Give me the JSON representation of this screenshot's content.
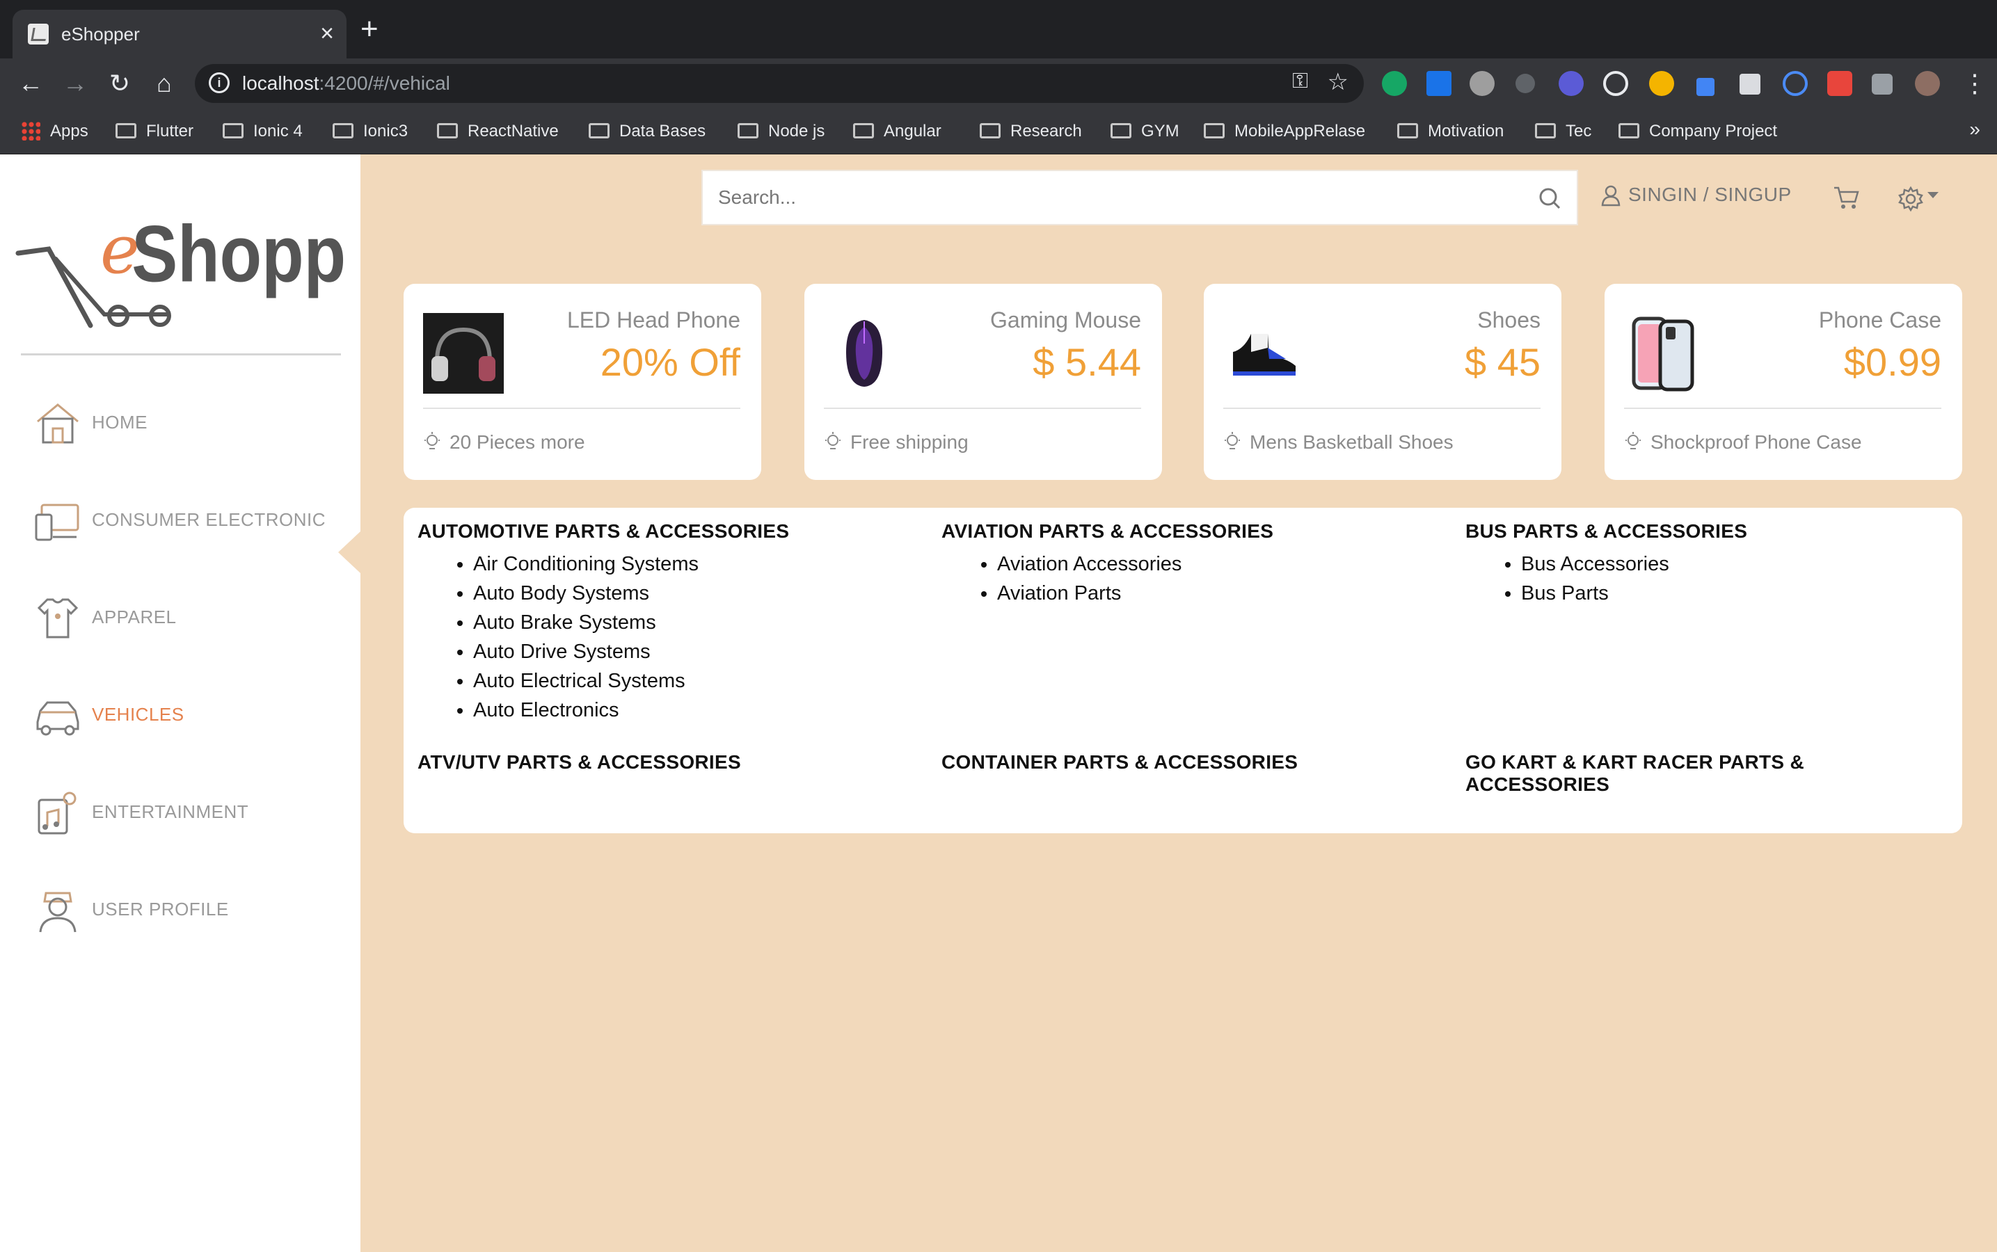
{
  "browser": {
    "tab_title": "eShopper",
    "url_host": "localhost",
    "url_path": ":4200/#/vehical",
    "bookmarks": [
      "Apps",
      "Flutter",
      "Ionic 4",
      "Ionic3",
      "ReactNative",
      "Data Bases",
      "Node js",
      "Angular",
      "Research",
      "GYM",
      "MobileAppRelase",
      "Motivation",
      "Tec",
      "Company Project"
    ],
    "more": "»"
  },
  "sidebar": {
    "items": [
      {
        "label": "HOME",
        "icon": "home-icon"
      },
      {
        "label": "CONSUMER ELECTRONIC",
        "icon": "devices-icon"
      },
      {
        "label": "APPAREL",
        "icon": "shirt-icon"
      },
      {
        "label": "VEHICLES",
        "icon": "car-icon",
        "active": true
      },
      {
        "label": "ENTERTAINMENT",
        "icon": "music-icon"
      },
      {
        "label": "USER PROFILE",
        "icon": "user-icon"
      }
    ],
    "active_color": "#e5824d"
  },
  "header": {
    "search_placeholder": "Search...",
    "signin_label": "SINGIN / SINGUP"
  },
  "deals": [
    {
      "name": "LED Head Phone",
      "price": "20% Off",
      "note": "20 Pieces more",
      "icon": "headphone-image"
    },
    {
      "name": "Gaming Mouse",
      "price": "$ 5.44",
      "note": "Free shipping",
      "icon": "mouse-image"
    },
    {
      "name": "Shoes",
      "price": "$ 45",
      "note": "Mens Basketball Shoes",
      "icon": "shoe-image"
    },
    {
      "name": "Phone Case",
      "price": "$0.99",
      "note": "Shockproof Phone Case",
      "icon": "phone-case-image"
    }
  ],
  "categories": [
    {
      "title": "AUTOMOTIVE PARTS & ACCESSORIES",
      "items": [
        "Air Conditioning Systems",
        "Auto Body Systems",
        "Auto Brake Systems",
        "Auto Drive Systems",
        "Auto Electrical Systems",
        "Auto Electronics"
      ]
    },
    {
      "title": "AVIATION PARTS & ACCESSORIES",
      "items": [
        "Aviation Accessories",
        "Aviation Parts"
      ]
    },
    {
      "title": "BUS PARTS & ACCESSORIES",
      "items": [
        "Bus Accessories",
        "Bus Parts"
      ]
    },
    {
      "title": "ATV/UTV PARTS & ACCESSORIES",
      "items": []
    },
    {
      "title": "CONTAINER PARTS & ACCESSORIES",
      "items": []
    },
    {
      "title": "GO KART & KART RACER PARTS & ACCESSORIES",
      "items": []
    }
  ],
  "colors": {
    "accent_price": "#f0a037",
    "background": "#f2d9bb"
  }
}
